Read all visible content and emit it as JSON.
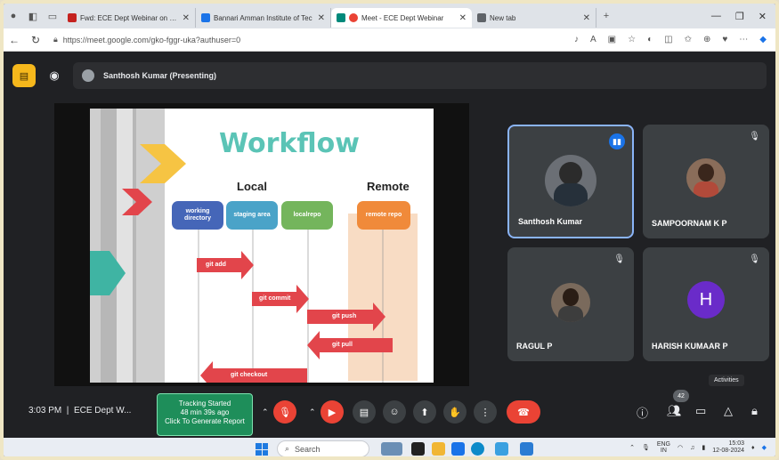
{
  "browser": {
    "tabs": [
      {
        "title": "Fwd: ECE Dept Webinar on 12/0",
        "favicon_color": "#c5221f"
      },
      {
        "title": "Bannari Amman Institute of Tec",
        "favicon_color": "#1a73e8"
      },
      {
        "title": "Meet - ECE Dept Webinar",
        "favicon_color": "#00897b",
        "active": true
      },
      {
        "title": "New tab",
        "favicon_color": "#5f6368"
      }
    ],
    "url": "https://meet.google.com/gko-fggr-uka?authuser=0"
  },
  "meet": {
    "presenting_label": "Santhosh Kumar (Presenting)",
    "slide": {
      "title": "Workflow",
      "local_label": "Local",
      "remote_label": "Remote",
      "stages": [
        "working directory",
        "staging area",
        "localrepo",
        "remote repo"
      ],
      "commands": [
        "git add",
        "git commit",
        "git push",
        "git pull",
        "git checkout"
      ]
    },
    "participants": [
      {
        "name": "Santhosh Kumar",
        "state": "speaking"
      },
      {
        "name": "SAMPOORNAM K P",
        "state": "muted"
      },
      {
        "name": "RAGUL P",
        "state": "muted"
      },
      {
        "name": "HARISH KUMAAR P",
        "state": "muted",
        "initial": "H"
      }
    ],
    "bottom": {
      "time": "3:03 PM",
      "meeting_title": "ECE Dept W...",
      "tracking_line1": "Tracking Started",
      "tracking_line2": "48 min 39s ago",
      "tracking_line3": "Click To Generate Report",
      "people_count": "42",
      "tooltip": "Activities"
    }
  },
  "taskbar": {
    "search_placeholder": "Search",
    "lang_top": "ENG",
    "lang_bottom": "IN",
    "time": "15:03",
    "date": "12-08-2024"
  },
  "colors": {
    "meet_bg": "#202124",
    "tile_bg": "#3c4043",
    "slide_teal": "#5bc4b6",
    "arrow_red": "#e2454b",
    "end_call_red": "#ea4335",
    "tracking_green": "#1e8e5a"
  }
}
